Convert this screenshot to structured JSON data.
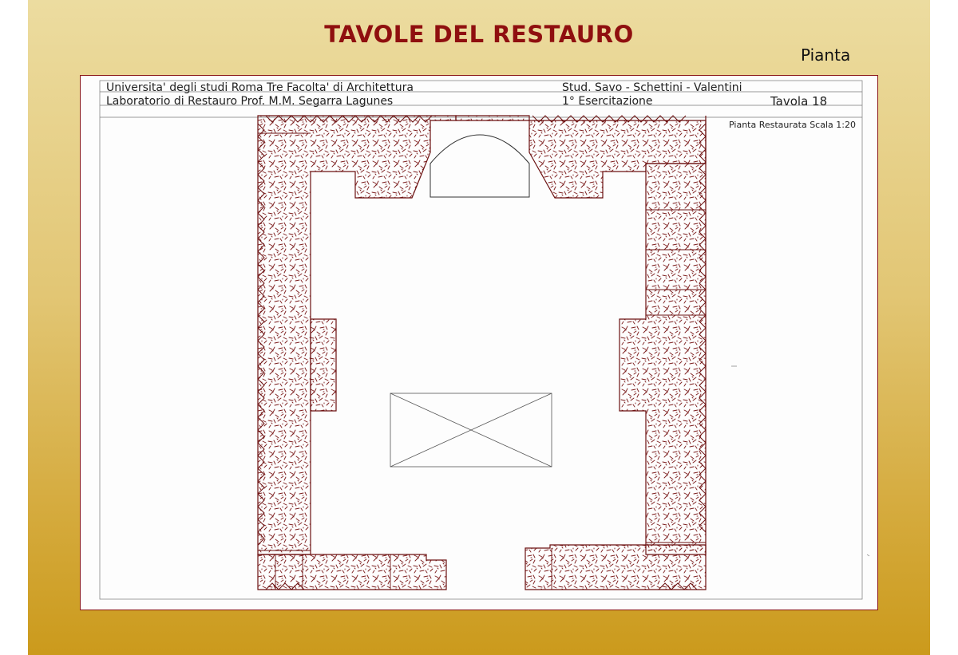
{
  "slide": {
    "title": "TAVOLE DEL RESTAURO",
    "subtitle": "Pianta"
  },
  "sheet": {
    "header": {
      "line1_left": "Universita' degli studi  Roma Tre  Facolta' di Architettura",
      "line1_right": "Stud.   Savo - Schettini - Valentini",
      "line2_left": "Laboratorio di Restauro    Prof. M.M. Segarra Lagunes",
      "line2_mid": "1° Esercitazione",
      "line2_right": "Tavola  18",
      "plan_caption": "Pianta Restaurata  Scala 1:20"
    }
  },
  "colors": {
    "title": "#8f0f0f",
    "wall_outline": "#6b1111",
    "hatch": "#7a1a1a",
    "background_top": "#ecdca0",
    "background_bottom": "#cb9a1c"
  }
}
